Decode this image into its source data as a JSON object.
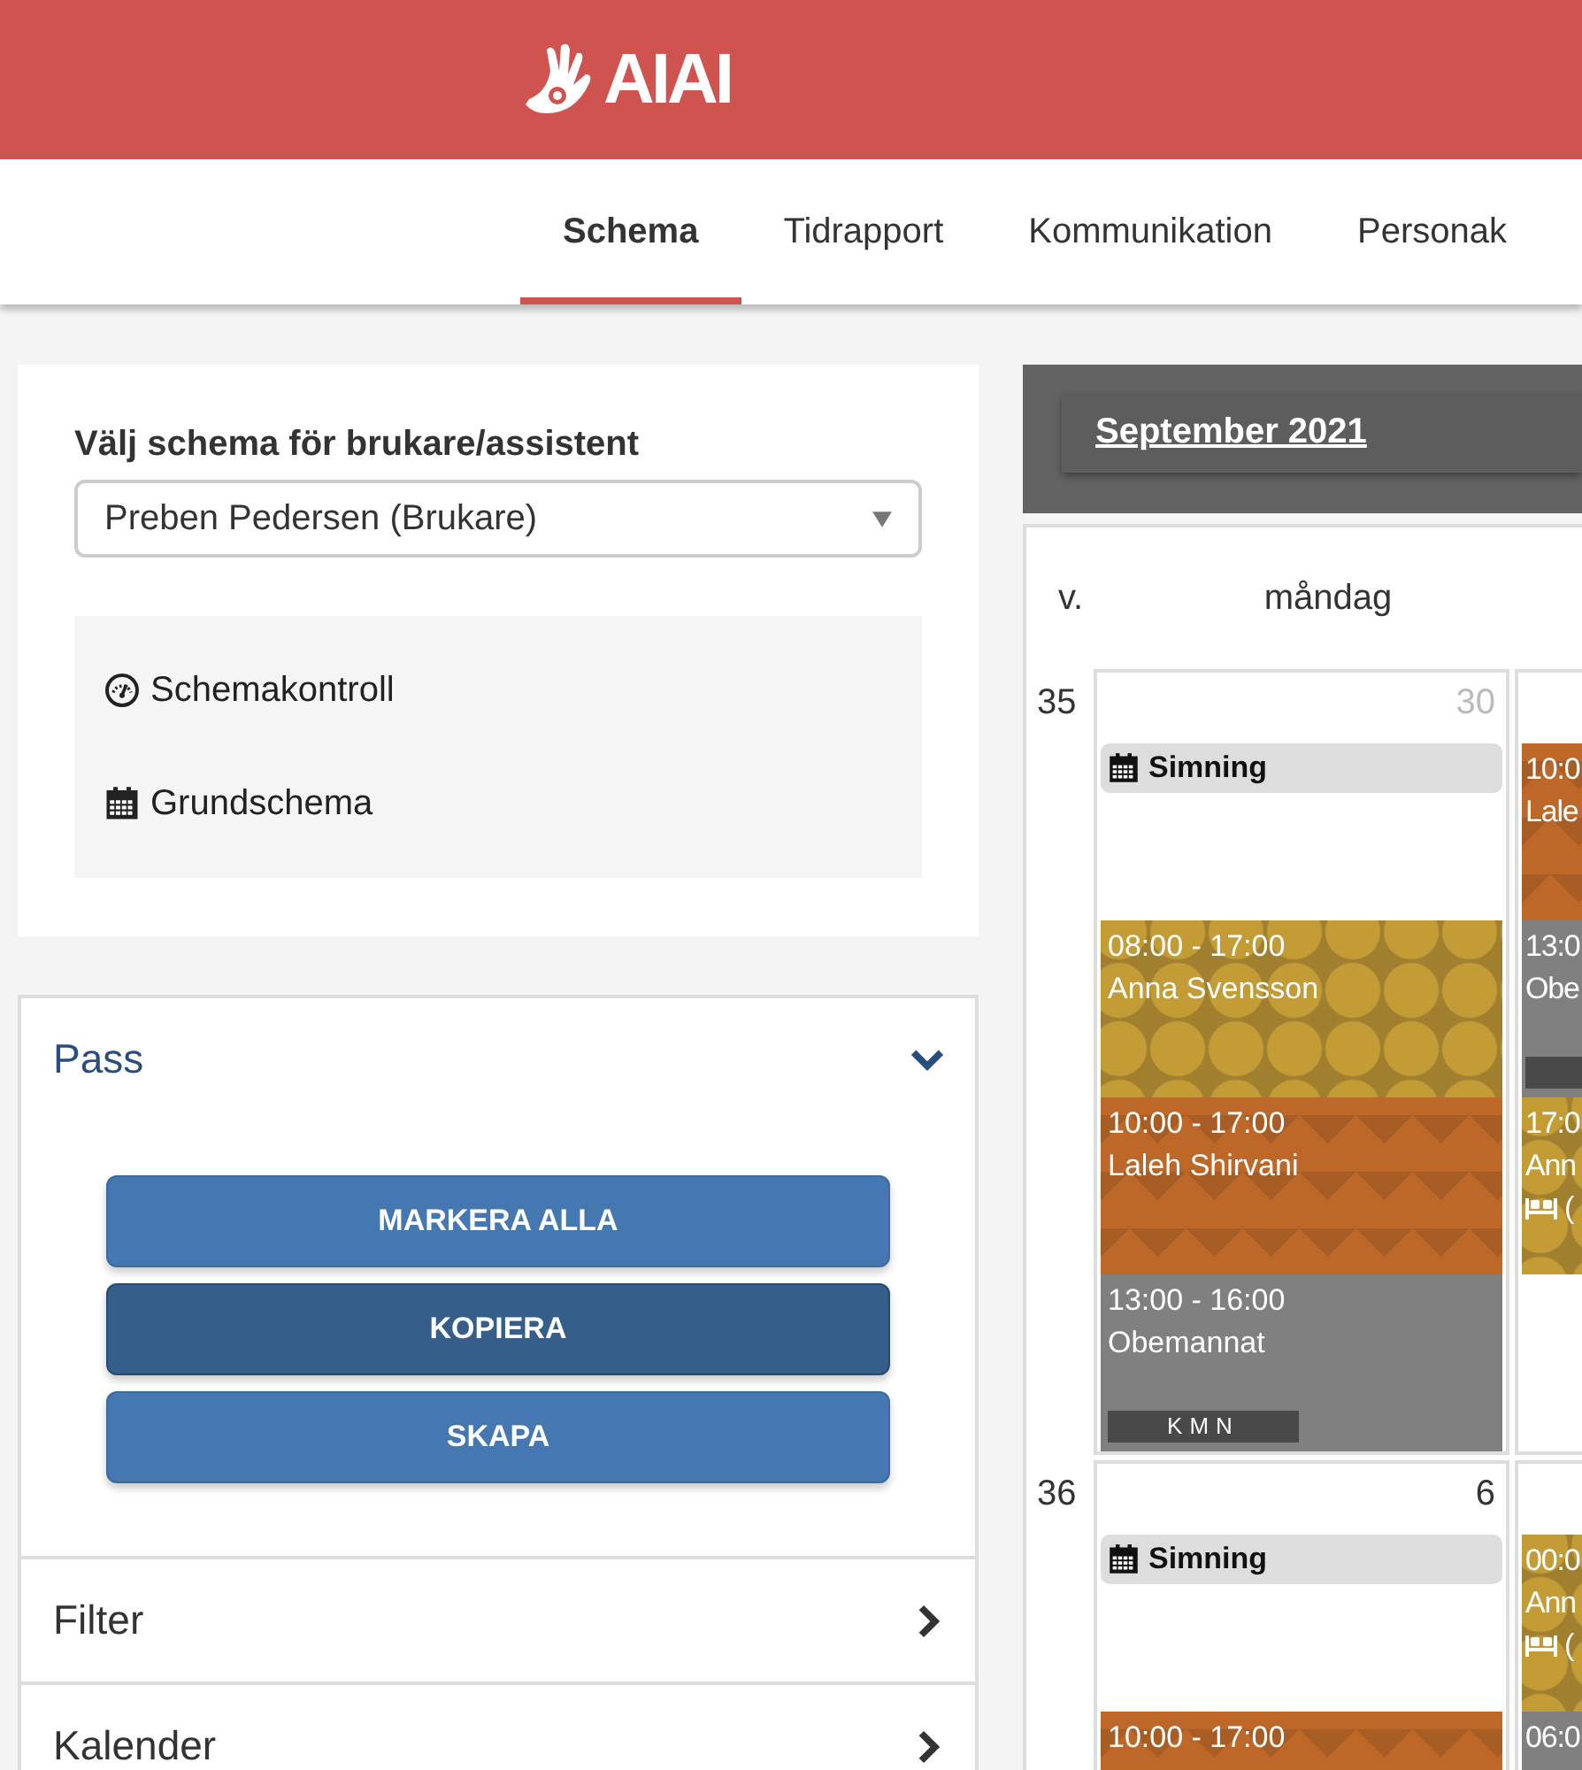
{
  "header": {
    "logo": "AIAI"
  },
  "tabs": [
    {
      "label": "Schema",
      "selected": true
    },
    {
      "label": "Tidrapport",
      "selected": false
    },
    {
      "label": "Kommunikation",
      "selected": false
    },
    {
      "label": "Personak",
      "selected": false
    }
  ],
  "schedule_picker": {
    "label": "Välj schema för brukare/assistent",
    "value": "Preben Pedersen (Brukare)"
  },
  "links": [
    {
      "kind": "gauge",
      "label": "Schemakontroll"
    },
    {
      "kind": "calendar",
      "label": "Grundschema"
    }
  ],
  "accordion": [
    {
      "title": "Pass",
      "expanded": true,
      "buttons": [
        {
          "label": "MARKERA ALLA",
          "pressed": false
        },
        {
          "label": "KOPIERA",
          "pressed": true
        },
        {
          "label": "SKAPA",
          "pressed": false
        }
      ]
    },
    {
      "title": "Filter",
      "expanded": false
    },
    {
      "title": "Kalender",
      "expanded": false
    }
  ],
  "calendar": {
    "month": "September 2021",
    "week_label": "v.",
    "day_header": "måndag",
    "weeks": [
      {
        "week": "35",
        "date": "30",
        "date_muted": true,
        "days": [
          {
            "events": [
              {
                "kind": "note",
                "title": "Simning"
              },
              {
                "kind": "dots",
                "time": "08:00 - 17:00",
                "name": "Anna Svensson"
              },
              {
                "kind": "zigzag",
                "time": "10:00 - 17:00",
                "name": "Laleh Shirvani"
              },
              {
                "kind": "plain",
                "time": "13:00 - 16:00",
                "name": "Obemannat",
                "tagged": true,
                "badge": "KMN"
              }
            ]
          },
          {
            "events": [
              {
                "kind": "zigzag",
                "time": "10:0",
                "name": "Lale"
              },
              {
                "kind": "plain",
                "time": "13:0",
                "name": "Obe",
                "tagged": true
              },
              {
                "kind": "dots",
                "time": "17:0",
                "name": "Ann",
                "sleep": true,
                "extra": "("
              }
            ]
          }
        ]
      },
      {
        "week": "36",
        "date": "6",
        "date_muted": false,
        "days": [
          {
            "events": [
              {
                "kind": "note",
                "title": "Simning"
              },
              {
                "kind": "zigzag",
                "time": "10:00 - 17:00"
              }
            ]
          },
          {
            "events": [
              {
                "kind": "dots",
                "time": "00:0",
                "name": "Ann",
                "sleep": true,
                "extra": "("
              },
              {
                "kind": "plain",
                "time": "06:0"
              }
            ]
          }
        ]
      }
    ]
  }
}
